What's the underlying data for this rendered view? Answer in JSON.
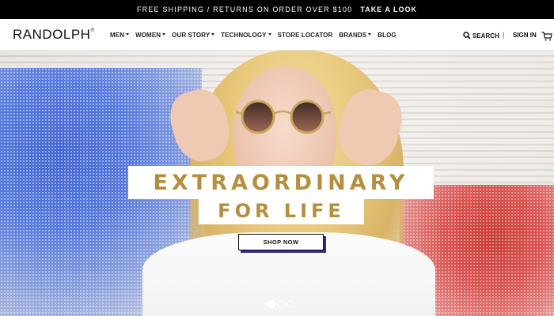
{
  "promo": {
    "text": "FREE SHIPPING / RETURNS ON ORDER OVER $100",
    "cta": "TAKE A LOOK"
  },
  "header": {
    "logo": "RANDOLPH",
    "logo_mark": "®",
    "nav": [
      {
        "label": "MEN",
        "has_dropdown": true
      },
      {
        "label": "WOMEN",
        "has_dropdown": true
      },
      {
        "label": "OUR STORY",
        "has_dropdown": true
      },
      {
        "label": "TECHNOLOGY",
        "has_dropdown": true
      },
      {
        "label": "STORE LOCATOR",
        "has_dropdown": false
      },
      {
        "label": "BRANDS",
        "has_dropdown": true
      },
      {
        "label": "BLOG",
        "has_dropdown": false
      }
    ],
    "search_label": "SEARCH",
    "divider": "|",
    "signin_label": "SIGN IN",
    "icons": {
      "search": "search-icon",
      "cart": "cart-icon"
    }
  },
  "hero": {
    "headline_line1": "EXTRAORDINARY",
    "headline_line2": "FOR LIFE",
    "cta": "SHOP NOW",
    "carousel_slides": 3,
    "carousel_active_index": 0
  },
  "colors": {
    "headline_gold": "#b58f3e",
    "promo_bg": "#000000",
    "button_shadow": "#2d2d8a",
    "blue_accent": "#3a5fcf",
    "red_accent": "#c83a37"
  }
}
